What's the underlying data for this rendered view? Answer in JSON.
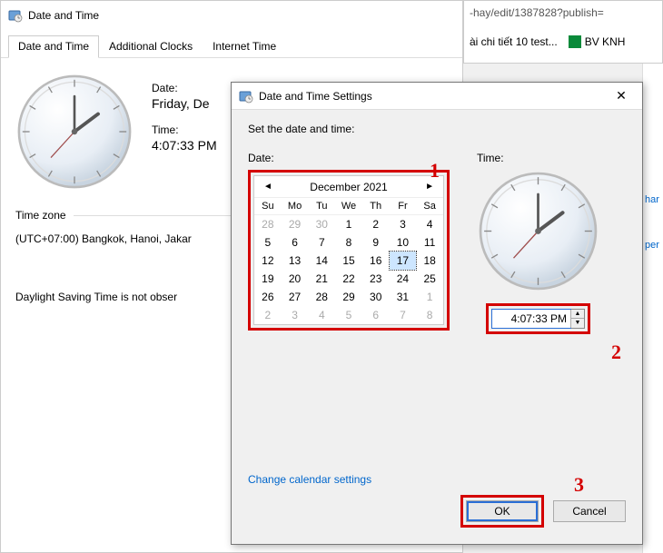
{
  "bg_window": {
    "title": "Date and Time",
    "tabs": [
      "Date and Time",
      "Additional Clocks",
      "Internet Time"
    ],
    "date_label": "Date:",
    "date_value": "Friday, De",
    "time_label": "Time:",
    "time_value": "4:07:33 PM",
    "tz_label": "Time zone",
    "tz_value": "(UTC+07:00) Bangkok, Hanoi, Jakar",
    "dst": "Daylight Saving Time is not obser"
  },
  "browser": {
    "url_fragment": "-hay/edit/1387828?publish=",
    "bookmark1": "ài chi tiết 10 test...",
    "bookmark2": "BV KNH",
    "side1": "har",
    "side2": "per"
  },
  "dialog": {
    "title": "Date and Time Settings",
    "instruction": "Set the date and time:",
    "date_label": "Date:",
    "time_label": "Time:",
    "calendar": {
      "month_year": "December 2021",
      "dow": [
        "Su",
        "Mo",
        "Tu",
        "We",
        "Th",
        "Fr",
        "Sa"
      ],
      "days": [
        {
          "n": 28,
          "dim": true
        },
        {
          "n": 29,
          "dim": true
        },
        {
          "n": 30,
          "dim": true
        },
        {
          "n": 1
        },
        {
          "n": 2
        },
        {
          "n": 3
        },
        {
          "n": 4
        },
        {
          "n": 5
        },
        {
          "n": 6
        },
        {
          "n": 7
        },
        {
          "n": 8
        },
        {
          "n": 9
        },
        {
          "n": 10
        },
        {
          "n": 11
        },
        {
          "n": 12
        },
        {
          "n": 13
        },
        {
          "n": 14
        },
        {
          "n": 15
        },
        {
          "n": 16
        },
        {
          "n": 17,
          "sel": true
        },
        {
          "n": 18
        },
        {
          "n": 19
        },
        {
          "n": 20
        },
        {
          "n": 21
        },
        {
          "n": 22
        },
        {
          "n": 23
        },
        {
          "n": 24
        },
        {
          "n": 25
        },
        {
          "n": 26
        },
        {
          "n": 27
        },
        {
          "n": 28
        },
        {
          "n": 29
        },
        {
          "n": 30
        },
        {
          "n": 31
        },
        {
          "n": 1,
          "dim": true
        },
        {
          "n": 2,
          "dim": true
        },
        {
          "n": 3,
          "dim": true
        },
        {
          "n": 4,
          "dim": true
        },
        {
          "n": 5,
          "dim": true
        },
        {
          "n": 6,
          "dim": true
        },
        {
          "n": 7,
          "dim": true
        },
        {
          "n": 8,
          "dim": true
        }
      ]
    },
    "time_value": "4:07:33 PM",
    "link": "Change calendar settings",
    "ok": "OK",
    "cancel": "Cancel"
  },
  "annotations": {
    "a1": "1",
    "a2": "2",
    "a3": "3"
  }
}
